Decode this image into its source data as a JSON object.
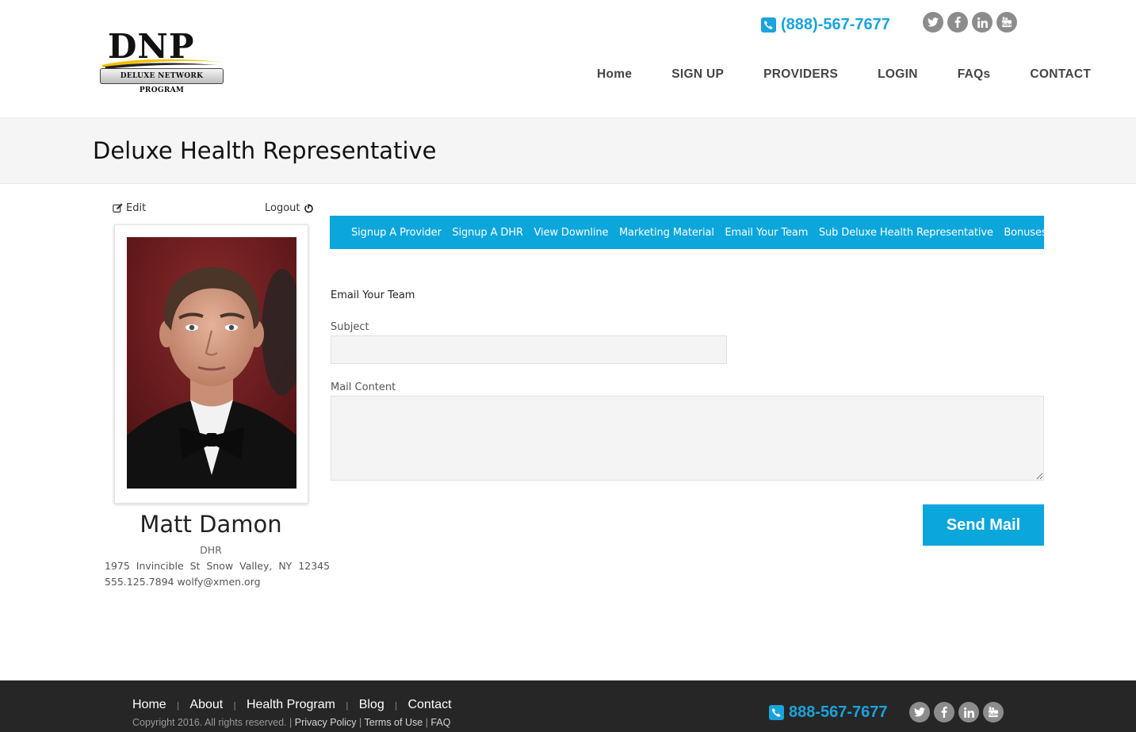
{
  "brand": {
    "logo_text": "DNP",
    "logo_subtext": "DELUXE NETWORK PROGRAM"
  },
  "header": {
    "phone": "(888)-567-7677",
    "social": [
      "twitter-icon",
      "facebook-icon",
      "linkedin-icon",
      "youtube-icon"
    ],
    "nav": [
      {
        "label": "Home"
      },
      {
        "label": "SIGN UP"
      },
      {
        "label": "PROVIDERS"
      },
      {
        "label": "LOGIN"
      },
      {
        "label": "FAQs"
      },
      {
        "label": "CONTACT"
      }
    ]
  },
  "page": {
    "title": "Deluxe Health Representative"
  },
  "profile": {
    "edit_label": "Edit",
    "logout_label": "Logout",
    "name": "Matt Damon",
    "role": "DHR",
    "address": "1975 Invincible St Snow Valley, NY 12345",
    "phone": "555.125.7894",
    "email": "wolfy@xmen.org"
  },
  "subnav": [
    {
      "label": "Signup A Provider"
    },
    {
      "label": "Signup A DHR"
    },
    {
      "label": "View Downline"
    },
    {
      "label": "Marketing Material"
    },
    {
      "label": "Email Your Team"
    },
    {
      "label": "Sub Deluxe Health Representative"
    },
    {
      "label": "Bonuses"
    }
  ],
  "form": {
    "heading": "Email Your Team",
    "subject_label": "Subject",
    "subject_value": "",
    "content_label": "Mail Content",
    "content_value": "",
    "send_label": "Send Mail"
  },
  "footer": {
    "links": [
      {
        "label": "Home"
      },
      {
        "label": "About"
      },
      {
        "label": "Health Program"
      },
      {
        "label": "Blog"
      },
      {
        "label": "Contact"
      }
    ],
    "separator": "|",
    "copyright": "Copyright 2016. All rights reserved.",
    "legal_sep": "|",
    "privacy": "Privacy Policy",
    "terms": "Terms of Use",
    "faq": "FAQ",
    "phone": "888-567-7677"
  },
  "colors": {
    "accent": "#0aa6dc",
    "footer_bg": "#262626",
    "title_bar_bg": "#f5f5f5"
  }
}
